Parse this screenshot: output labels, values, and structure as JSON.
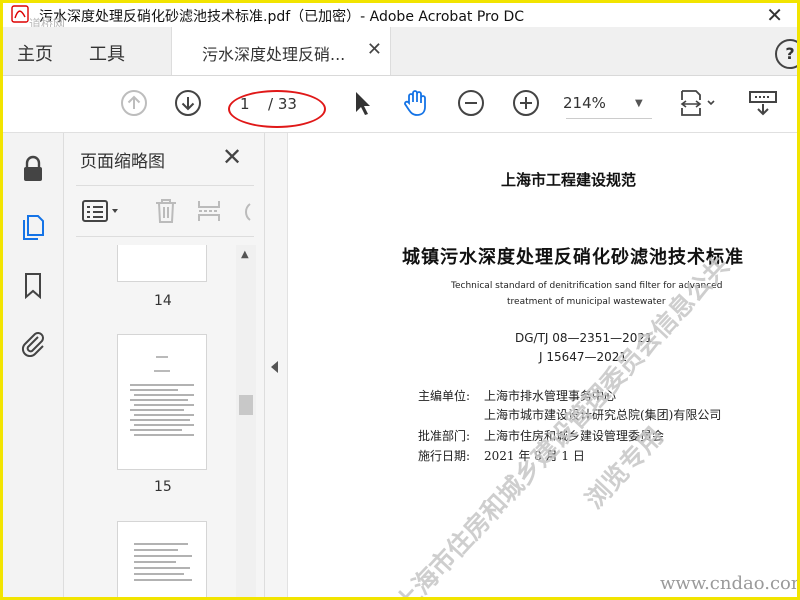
{
  "window": {
    "title": "污水深度处理反硝化砂滤池技术标准.pdf（已加密）- Adobe Acrobat Pro DC",
    "site_mark": "道桥网"
  },
  "tabs": {
    "home": "主页",
    "tools": "工具",
    "document": "污水深度处理反硝...",
    "help": "?"
  },
  "toolbar": {
    "page_current": "1",
    "page_total": "/ 33",
    "zoom": "214%"
  },
  "thumbnails": {
    "panel_title": "页面缩略图",
    "pages": [
      {
        "label": "14"
      },
      {
        "label": "15"
      }
    ]
  },
  "document": {
    "series": "上海市工程建设规范",
    "title": "城镇污水深度处理反硝化砂滤池技术标准",
    "english_line1": "Technical standard of denitrification sand filter for advanced",
    "english_line2": "treatment of municipal wastewater",
    "code1": "DG/TJ 08—2351—2021",
    "code2": "J 15647—2021",
    "editor_label": "主编单位:",
    "editor_1": "上海市排水管理事务中心",
    "editor_2": "上海市城市建设设计研究总院(集团)有限公司",
    "approver_label": "批准部门:",
    "approver": "上海市住房和城乡建设管理委员会",
    "effective_label": "施行日期:",
    "effective_date": "2021 年 8 月 1 日"
  },
  "watermark": {
    "line1": "上海市住房和城乡建设管理委员会信息公共",
    "line2": "浏览专用"
  },
  "footer_site": "www.cndao.com",
  "colors": {
    "accent_blue": "#1473e6",
    "frame_yellow": "#f2e400",
    "annotation_red": "#e01818"
  }
}
